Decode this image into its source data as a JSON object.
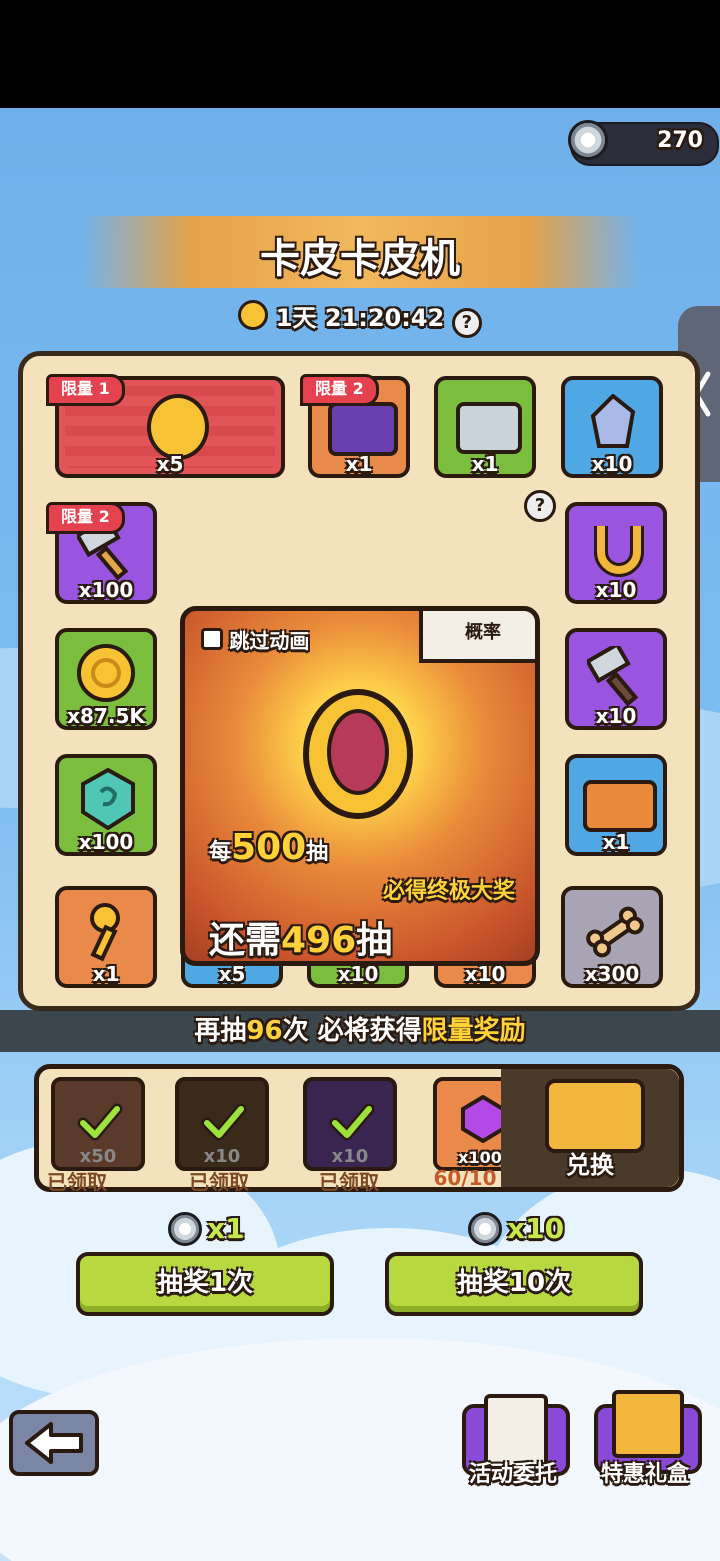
{
  "currency": {
    "amount": "270",
    "icon": "silver-coin-icon"
  },
  "title": "卡皮卡皮机",
  "timer": {
    "value": "1天 21:20:42"
  },
  "tiles": [
    {
      "count": "x5",
      "tag": "限量 1",
      "item": "capybara-coin",
      "color": "red"
    },
    {
      "count": "x1",
      "tag": "限量 2",
      "item": "purple-chest",
      "color": "orange"
    },
    {
      "count": "x1",
      "item": "silver-chest",
      "color": "green"
    },
    {
      "count": "x10",
      "item": "crystal",
      "color": "blue"
    },
    {
      "count": "x100",
      "tag": "限量 2",
      "item": "hammer",
      "color": "purple"
    },
    {
      "count": "x10",
      "item": "horseshoe",
      "color": "purple"
    },
    {
      "count": "x87.5K",
      "item": "gold-coin",
      "color": "green"
    },
    {
      "count": "x10",
      "item": "hammer",
      "color": "purple"
    },
    {
      "count": "x100",
      "item": "jade-stone",
      "color": "green"
    },
    {
      "count": "x1",
      "item": "gold-chest",
      "color": "blue"
    },
    {
      "count": "x1",
      "item": "key",
      "color": "orange"
    },
    {
      "count": "x5",
      "item": "scroll",
      "color": "blue"
    },
    {
      "count": "x10",
      "item": "rune-stone",
      "color": "green"
    },
    {
      "count": "x10",
      "item": "egg",
      "color": "orange"
    },
    {
      "count": "x300",
      "item": "bone",
      "color": "gray"
    }
  ],
  "center": {
    "skip_label": "跳过动画",
    "prob_label": "概率",
    "every_prefix": "每",
    "every_num": "500",
    "every_suffix": "抽",
    "guarantee": "必得终极大奖",
    "remain_prefix": "还需",
    "remain_num": "496",
    "remain_suffix": "抽"
  },
  "progress": {
    "p1": "再抽",
    "num": "96",
    "p2": "次 必将获得",
    "p3": "限量奖励"
  },
  "rewards": [
    {
      "count": "x50",
      "status": "已领取"
    },
    {
      "count": "x10",
      "status": "已领取"
    },
    {
      "count": "x10",
      "status": "已领取"
    },
    {
      "count": "x100",
      "status": "60/10"
    }
  ],
  "exchange_label": "兑换",
  "draw": [
    {
      "cost": "x1",
      "label": "抽奖1次"
    },
    {
      "cost": "x10",
      "label": "抽奖10次"
    }
  ],
  "bottom": {
    "tasks": "活动委托",
    "gift": "特惠礼盒"
  }
}
